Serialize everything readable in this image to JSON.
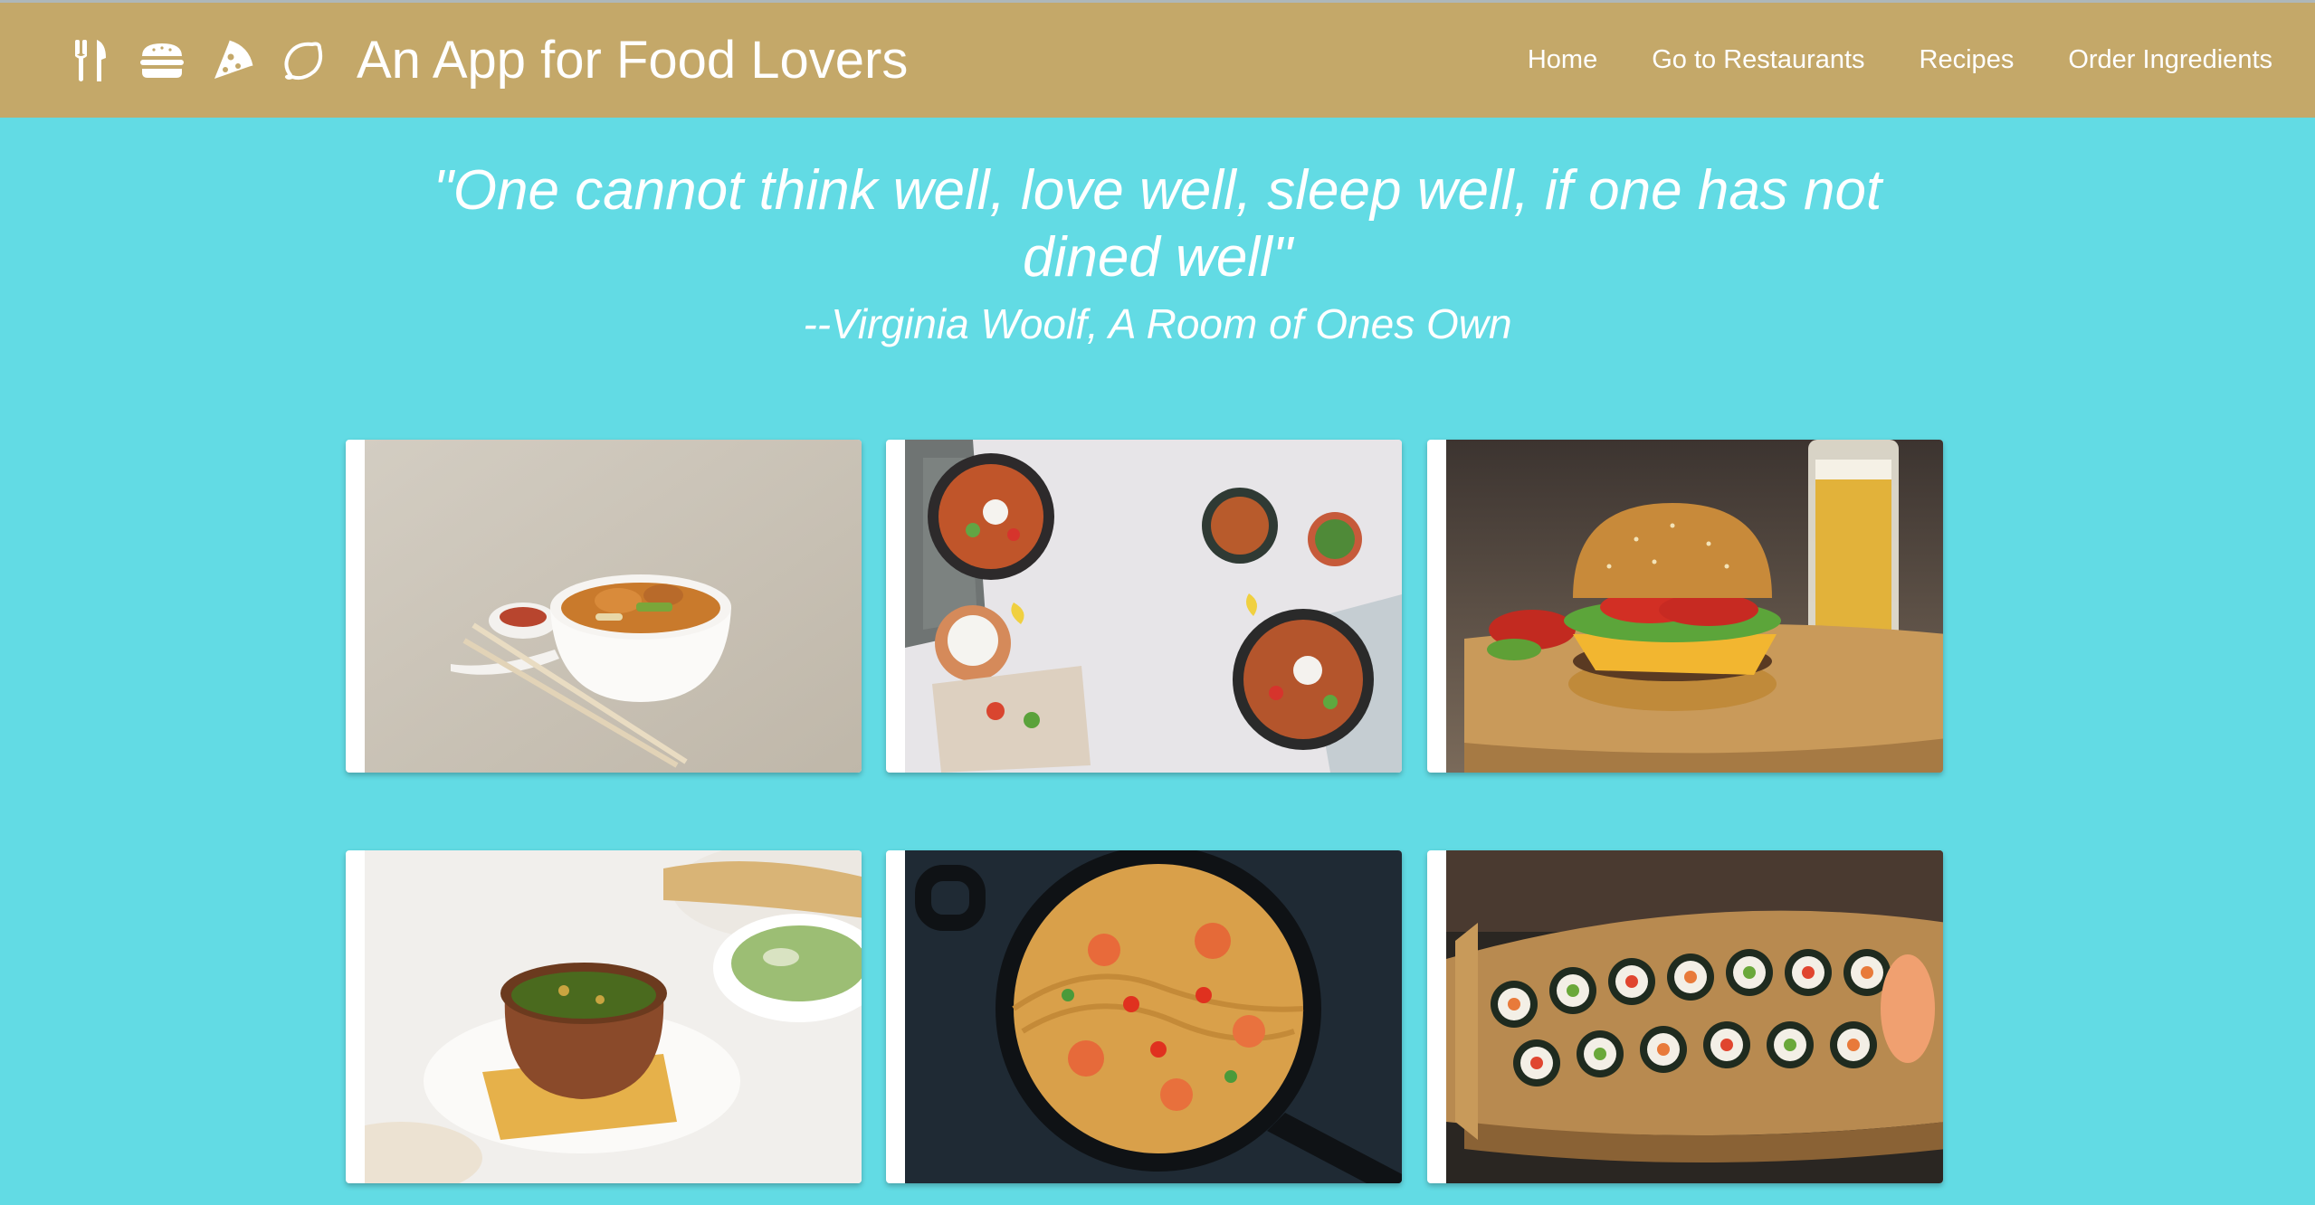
{
  "colors": {
    "navbar_bg": "#c4a869",
    "page_bg": "#62dbe4"
  },
  "header": {
    "icons": [
      "fork-knife-icon",
      "burger-icon",
      "pizza-icon",
      "lemon-icon"
    ],
    "title": "An App for Food Lovers"
  },
  "nav": {
    "items": [
      {
        "label": "Home"
      },
      {
        "label": "Go to Restaurants"
      },
      {
        "label": "Recipes"
      },
      {
        "label": "Order Ingredients"
      }
    ]
  },
  "quote": {
    "text": "\"One cannot think well, love well, sleep well, if one has not dined well\"",
    "author": "--Virginia Woolf, A Room of Ones Own"
  },
  "gallery": {
    "cards": [
      {
        "photo": "noodle-soup-photo"
      },
      {
        "photo": "loaded-fries-photo"
      },
      {
        "photo": "burger-photo"
      },
      {
        "photo": "curry-photo"
      },
      {
        "photo": "shrimp-pasta-photo"
      },
      {
        "photo": "sushi-boat-photo"
      }
    ]
  }
}
